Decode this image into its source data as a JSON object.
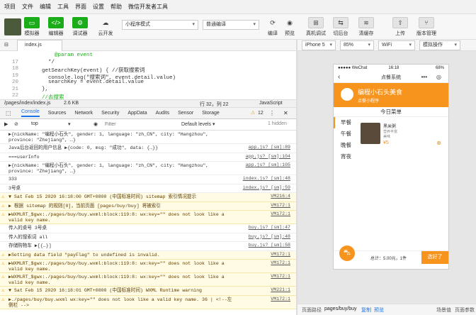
{
  "menubar": [
    "项目",
    "文件",
    "编辑",
    "工具",
    "界面",
    "设置",
    "帮助",
    "微信开发者工具"
  ],
  "toolbar": {
    "simulator": "模拟器",
    "editor": "编辑器",
    "debugger": "调试器",
    "cloud": "云开发",
    "mode": "小程序模式",
    "compile_mode": "普通编译",
    "compile": "编译",
    "preview": "预览",
    "remote_debug": "真机调试",
    "cut_back": "切后台",
    "clear_cache": "清缓存",
    "upload": "上传",
    "version": "版本管理"
  },
  "file_tab": "index.js",
  "editor": {
    "lines": [
      {
        "n": "",
        "t": "      @param event"
      },
      {
        "n": "17",
        "t": "    */"
      },
      {
        "n": "18",
        "t": "  getSearchKey(event) { //获取搜索词"
      },
      {
        "n": "19",
        "t": "    console.log(\"搜索词\", event.detail.value)"
      },
      {
        "n": "20",
        "t": "    searchKey = event.detail.value"
      },
      {
        "n": "21",
        "t": "  },"
      },
      {
        "n": "22",
        "t": "  //去搜索"
      }
    ]
  },
  "status": {
    "path": "/pages/index/index.js",
    "size": "2.6 KB",
    "pos": "行 32，列 22",
    "lang": "JavaScript"
  },
  "devtools_tabs": [
    "Console",
    "Sources",
    "Network",
    "Security",
    "AppData",
    "Audits",
    "Sensor",
    "Storage"
  ],
  "warn_count": "12",
  "filter": {
    "context": "top",
    "placeholder": "Filter",
    "levels": "Default levels ▾",
    "hidden": "1 hidden"
  },
  "console": [
    {
      "type": "log",
      "msg": "▶{nickName: \"编程小石头\", gender: 1, language: \"zh_CN\", city: \"Hangzhou\", province: \"Zhejiang\", …}",
      "src": ""
    },
    {
      "type": "log",
      "msg": "Java后台返回的用户信息 ▶{code: 0, msg: \"成功\", data: {…}}",
      "src": "app.js? [sm]:89"
    },
    {
      "type": "log",
      "msg": "===userInfo",
      "src": "app.js? [sm]:104"
    },
    {
      "type": "log",
      "msg": "▶{nickName: \"编程小石头\", gender: 1, language: \"zh_CN\", city: \"Hangzhou\", province: \"Zhejiang\", …}",
      "src": "app.js? [sm]:105"
    },
    {
      "type": "log",
      "msg": "333",
      "src": "index.js? [sm]:48"
    },
    {
      "type": "log",
      "msg": "3号桌",
      "src": "index.js? [sm]:59"
    },
    {
      "type": "warn",
      "msg": "▼ Sat Feb 15 2020 16:18:00 GMT+0800 (中国标准时间) sitemap 索引情况提示",
      "src": "VM216:4"
    },
    {
      "type": "warn",
      "msg": "  ▶ 根据 sitemap 的规则[0]，当前页面 [pages/buy/buy] 将被索引",
      "src": "VM172:1"
    },
    {
      "type": "warn",
      "msg": "▶WXMLRT_$gwx:./pages/buy/buy.wxml:block:119:8: wx:key=\"\" does not look like a valid key name.",
      "src": "VM172:1"
    },
    {
      "type": "log",
      "msg": "传入的桌号 3号桌",
      "src": "buy.js? [sm]:47"
    },
    {
      "type": "log",
      "msg": "传入的搜索词 all",
      "src": "buy.js? [sm]:48"
    },
    {
      "type": "log",
      "msg": "存储购物车 ▶[{…}]",
      "src": "buy.js? [sm]:58"
    },
    {
      "type": "warn",
      "msg": "▶Setting data field \"payFlag\" to undefined is invalid.",
      "src": "VM172:1"
    },
    {
      "type": "warn",
      "msg": "▶WXMLRT_$gwx:./pages/buy/buy.wxml:block:119:8: wx:key=\"\" does not look like a valid key name.",
      "src": "VM172:1"
    },
    {
      "type": "warn",
      "msg": "▶WXMLRT_$gwx:./pages/buy/buy.wxml:block:119:8: wx:key=\"\" does not look like a valid key name.",
      "src": "VM172:1"
    },
    {
      "type": "warn",
      "msg": "▼ Sat Feb 15 2020 16:18:01 GMT+0800 (中国标准时间) WXML Runtime warning",
      "src": "VM221:1"
    },
    {
      "type": "warn",
      "msg": "  ▶./pages/buy/buy.wxml  wx:key=\"\" does not look like a valid key name.  36 |   <!--左侧栏 -->",
      "src": "VM172:1"
    }
  ],
  "simulator": {
    "device": "iPhone 5",
    "zoom": "85%",
    "network": "WiFi",
    "op": "模拟操作",
    "carrier": "●●●●● WeChat",
    "time": "16:18",
    "battery": "68%",
    "nav_title": "点餐系统",
    "banner_title": "编程小石头美食",
    "banner_sub": "点餐小程序",
    "menu_title": "今日菜单",
    "categories": [
      "早餐",
      "午餐",
      "晚餐",
      "宵夜"
    ],
    "dish": {
      "name": "黑米粥",
      "desc1": "营养丰富",
      "desc2": "美味",
      "price": "¥5"
    },
    "total": "总计：5.00元，1件",
    "pay": "选好了"
  },
  "bottom": {
    "path_label": "页面路径",
    "path": "pages/buy/buy",
    "copy": "复制",
    "preview": "预览",
    "scene": "场景值",
    "params": "页面参数"
  }
}
